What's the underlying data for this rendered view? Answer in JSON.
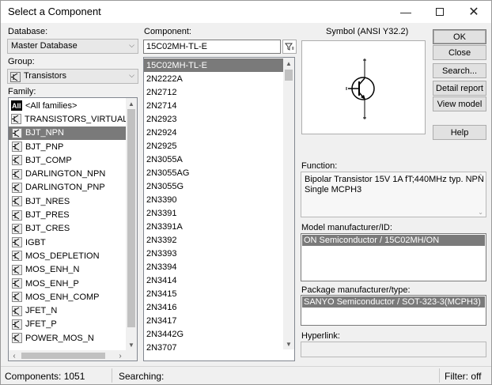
{
  "window": {
    "title": "Select a Component",
    "controls": [
      "minimize",
      "maximize",
      "close"
    ]
  },
  "database": {
    "label": "Database:",
    "value": "Master Database"
  },
  "group": {
    "label": "Group:",
    "value": "Transistors"
  },
  "family": {
    "label": "Family:",
    "items": [
      {
        "label": "<All families>",
        "icon": "all-families-icon",
        "selected": false
      },
      {
        "label": "TRANSISTORS_VIRTUAL",
        "icon": "virtual-transistor-icon",
        "selected": false
      },
      {
        "label": "BJT_NPN",
        "icon": "bjt-npn-icon",
        "selected": true
      },
      {
        "label": "BJT_PNP",
        "icon": "bjt-pnp-icon",
        "selected": false
      },
      {
        "label": "BJT_COMP",
        "icon": "bjt-comp-icon",
        "selected": false
      },
      {
        "label": "DARLINGTON_NPN",
        "icon": "darlington-npn-icon",
        "selected": false
      },
      {
        "label": "DARLINGTON_PNP",
        "icon": "darlington-pnp-icon",
        "selected": false
      },
      {
        "label": "BJT_NRES",
        "icon": "bjt-nres-icon",
        "selected": false
      },
      {
        "label": "BJT_PRES",
        "icon": "bjt-pres-icon",
        "selected": false
      },
      {
        "label": "BJT_CRES",
        "icon": "bjt-cres-icon",
        "selected": false
      },
      {
        "label": "IGBT",
        "icon": "igbt-icon",
        "selected": false
      },
      {
        "label": "MOS_DEPLETION",
        "icon": "mos-depletion-icon",
        "selected": false
      },
      {
        "label": "MOS_ENH_N",
        "icon": "mos-enh-n-icon",
        "selected": false
      },
      {
        "label": "MOS_ENH_P",
        "icon": "mos-enh-p-icon",
        "selected": false
      },
      {
        "label": "MOS_ENH_COMP",
        "icon": "mos-enh-comp-icon",
        "selected": false
      },
      {
        "label": "JFET_N",
        "icon": "jfet-n-icon",
        "selected": false
      },
      {
        "label": "JFET_P",
        "icon": "jfet-p-icon",
        "selected": false
      },
      {
        "label": "POWER_MOS_N",
        "icon": "power-mos-n-icon",
        "selected": false
      }
    ]
  },
  "component": {
    "label": "Component:",
    "value": "15C02MH-TL-E",
    "items": [
      "15C02MH-TL-E",
      "2N2222A",
      "2N2712",
      "2N2714",
      "2N2923",
      "2N2924",
      "2N2925",
      "2N3055A",
      "2N3055AG",
      "2N3055G",
      "2N3390",
      "2N3391",
      "2N3391A",
      "2N3392",
      "2N3393",
      "2N3394",
      "2N3414",
      "2N3415",
      "2N3416",
      "2N3417",
      "2N3442G",
      "2N3707"
    ],
    "selected_index": 0
  },
  "symbol": {
    "label": "Symbol (ANSI Y32.2)"
  },
  "buttons": {
    "ok": "OK",
    "close": "Close",
    "search": "Search...",
    "detail_report": "Detail report",
    "view_model": "View model",
    "help": "Help"
  },
  "function": {
    "label": "Function:",
    "text": "Bipolar Transistor 15V 1A fT;440MHz typ. NPN Single MCPH3"
  },
  "model": {
    "label": "Model manufacturer/ID:",
    "value": "ON Semiconductor / 15C02MH/ON"
  },
  "package": {
    "label": "Package manufacturer/type:",
    "value": "SANYO Semiconductor / SOT-323-3(MCPH3)"
  },
  "hyperlink": {
    "label": "Hyperlink:",
    "value": ""
  },
  "status": {
    "components": "Components: 1051",
    "searching": "Searching:",
    "filter": "Filter: off"
  }
}
